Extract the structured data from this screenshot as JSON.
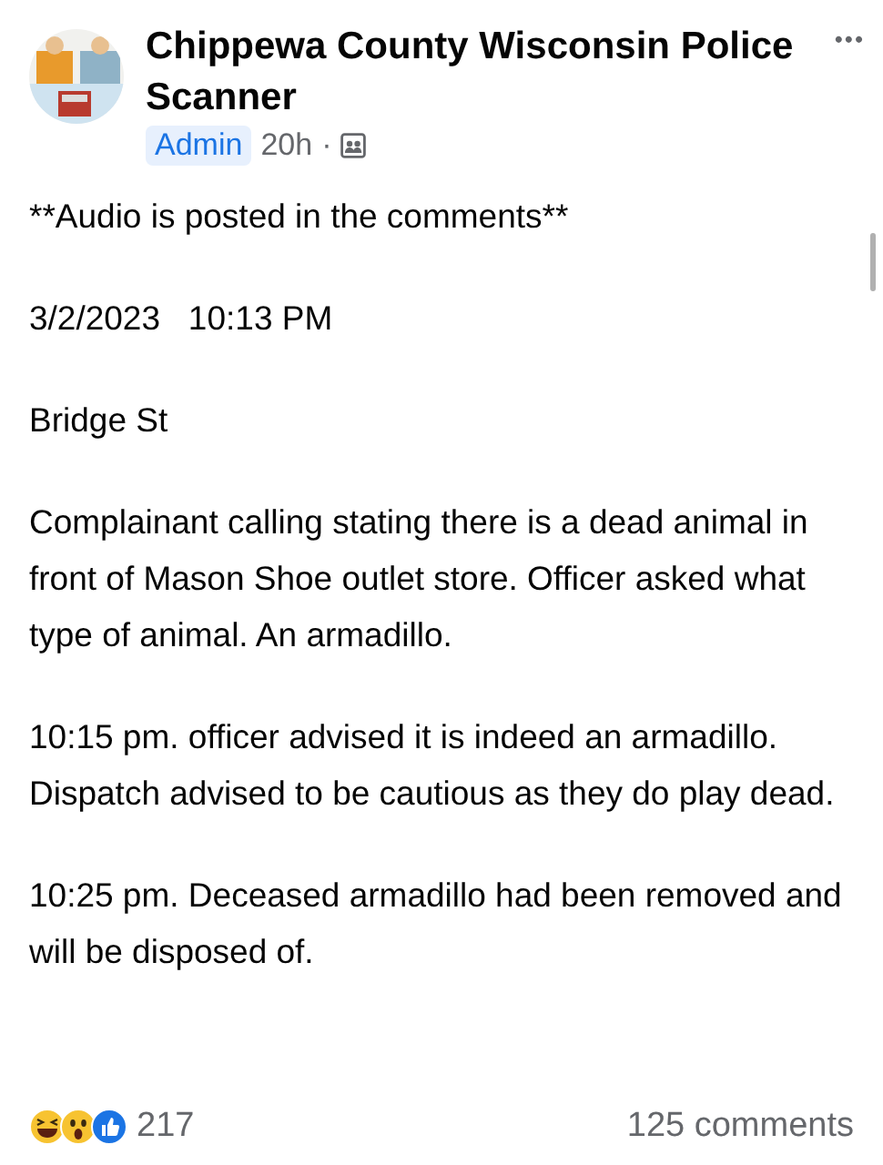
{
  "post": {
    "author": "Chippewa County Wisconsin Police Scanner",
    "badge": "Admin",
    "time": "20h",
    "separator": "·",
    "more": "•••",
    "paragraphs": [
      "**Audio is posted in the comments**",
      "3/2/2023   10:13 PM",
      "Bridge St",
      "Complainant calling stating there is a dead animal in front of Mason Shoe outlet store. Officer asked what type of animal. An armadillo.",
      "10:15 pm. officer advised it is indeed an armadillo. Dispatch advised to be cautious as they do play dead.",
      "10:25 pm. Deceased armadillo had been removed and will be disposed of."
    ],
    "reactions": [
      {
        "kind": "haha"
      },
      {
        "kind": "wow"
      },
      {
        "kind": "like"
      }
    ],
    "reaction_count": "217",
    "comments": "125 comments"
  }
}
